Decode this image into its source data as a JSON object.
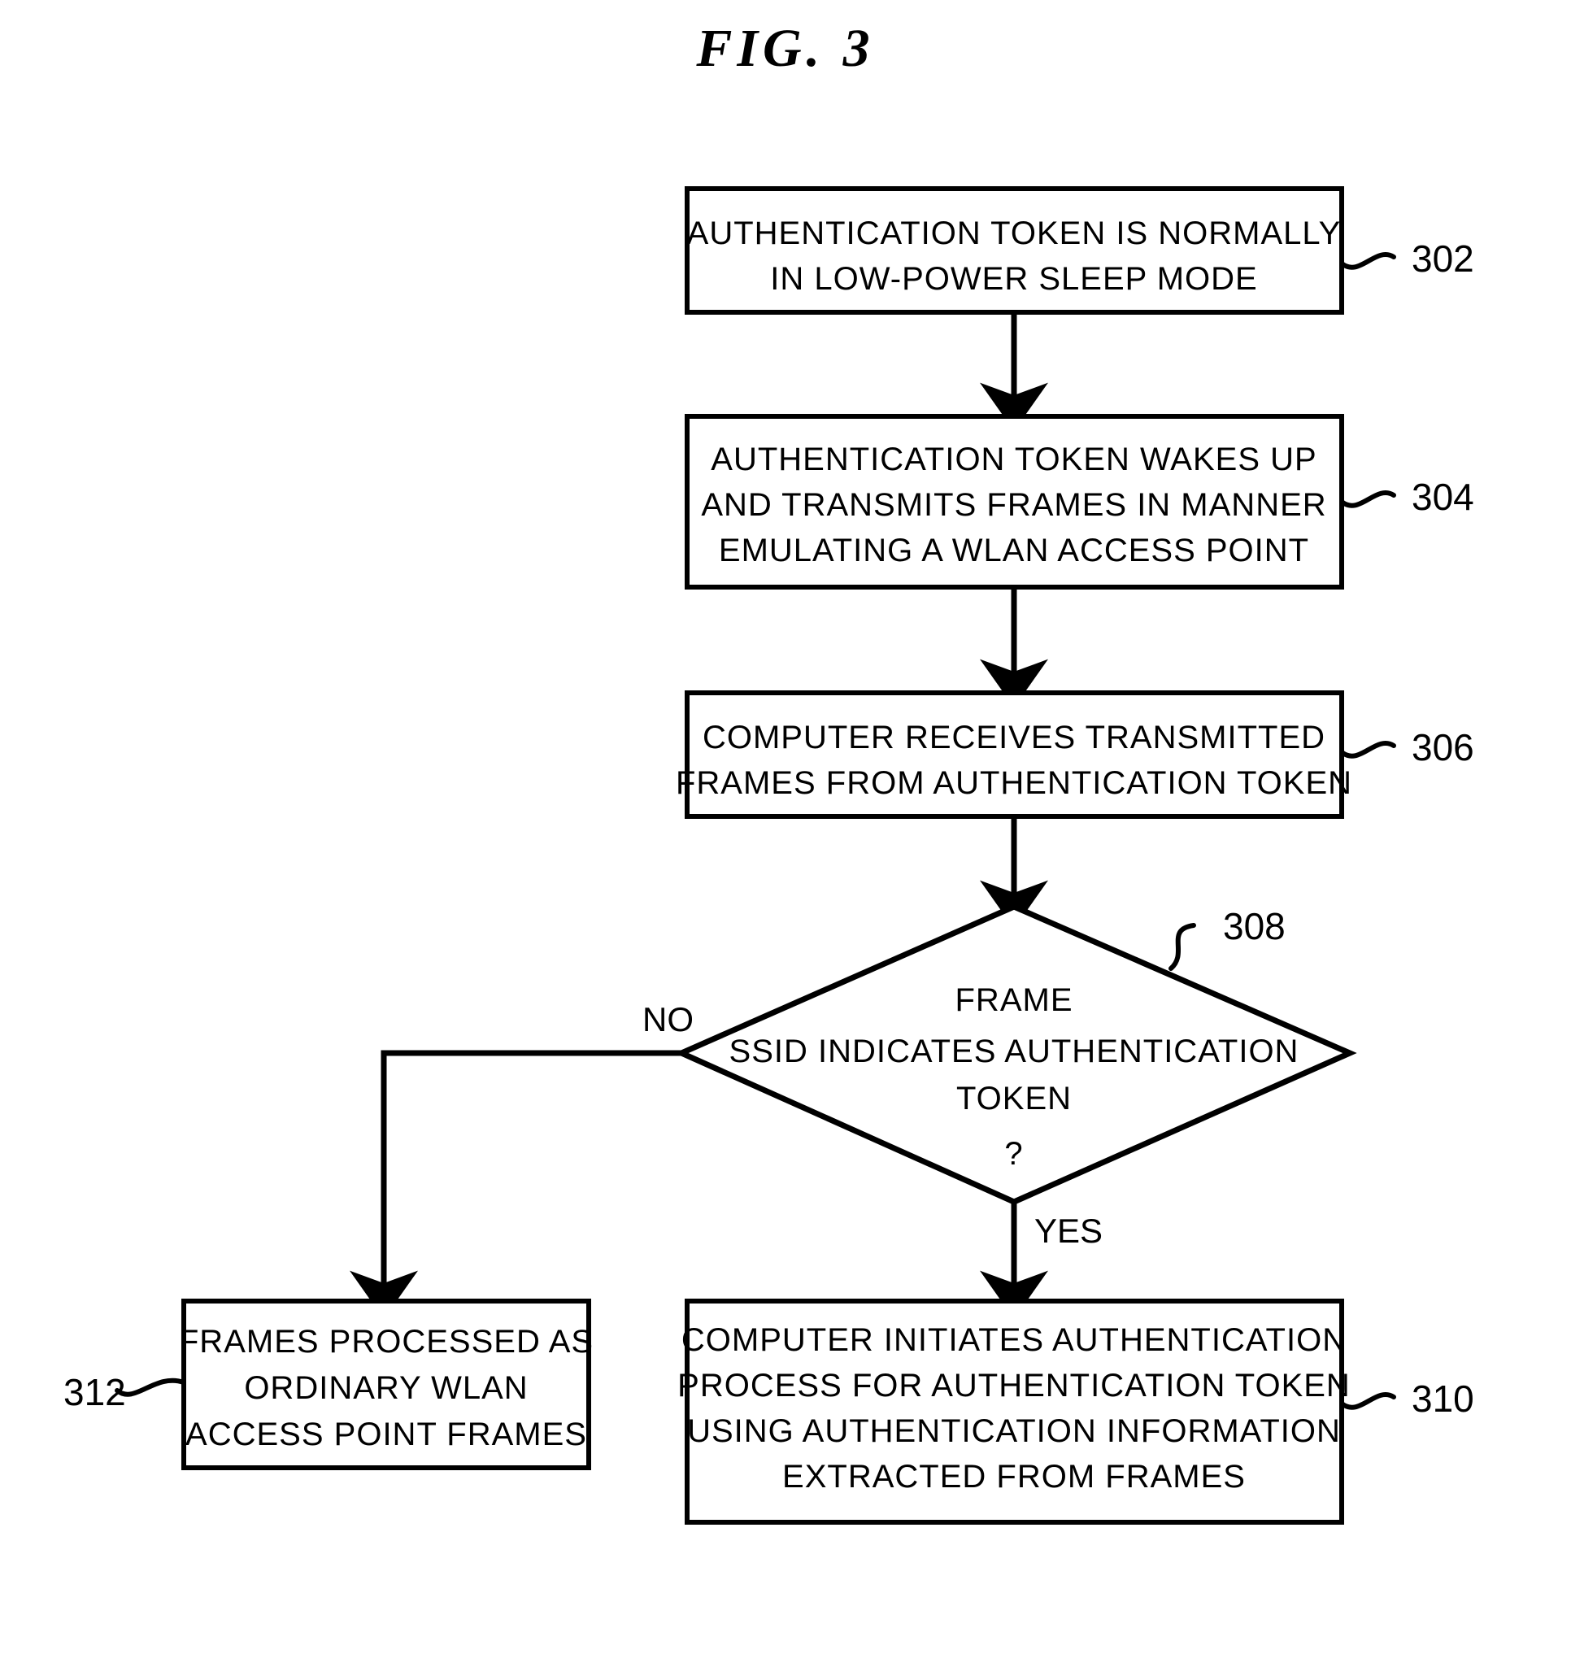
{
  "figure": {
    "title": "FIG.  3",
    "type": "patent-flowchart"
  },
  "nodes": [
    {
      "id": "302",
      "shape": "process-box",
      "ref": "302",
      "lines": [
        "AUTHENTICATION TOKEN IS NORMALLY",
        "IN LOW-POWER SLEEP MODE"
      ]
    },
    {
      "id": "304",
      "shape": "process-box",
      "ref": "304",
      "lines": [
        "AUTHENTICATION TOKEN WAKES UP",
        "AND TRANSMITS FRAMES IN MANNER",
        "EMULATING A WLAN ACCESS POINT"
      ]
    },
    {
      "id": "306",
      "shape": "process-box",
      "ref": "306",
      "lines": [
        "COMPUTER RECEIVES TRANSMITTED",
        "FRAMES FROM AUTHENTICATION TOKEN"
      ]
    },
    {
      "id": "308",
      "shape": "decision-diamond",
      "ref": "308",
      "lines": [
        "FRAME",
        "SSID INDICATES AUTHENTICATION",
        "TOKEN",
        "?"
      ]
    },
    {
      "id": "310",
      "shape": "process-box",
      "ref": "310",
      "lines": [
        "COMPUTER INITIATES AUTHENTICATION",
        "PROCESS FOR AUTHENTICATION TOKEN",
        "USING AUTHENTICATION INFORMATION",
        "EXTRACTED FROM FRAMES"
      ]
    },
    {
      "id": "312",
      "shape": "process-box",
      "ref": "312",
      "lines": [
        "FRAMES PROCESSED AS",
        "ORDINARY WLAN",
        "ACCESS POINT FRAMES"
      ]
    }
  ],
  "branch_labels": {
    "no": "NO",
    "yes": "YES"
  },
  "colors": {
    "ink": "#000000",
    "paper": "#ffffff"
  }
}
